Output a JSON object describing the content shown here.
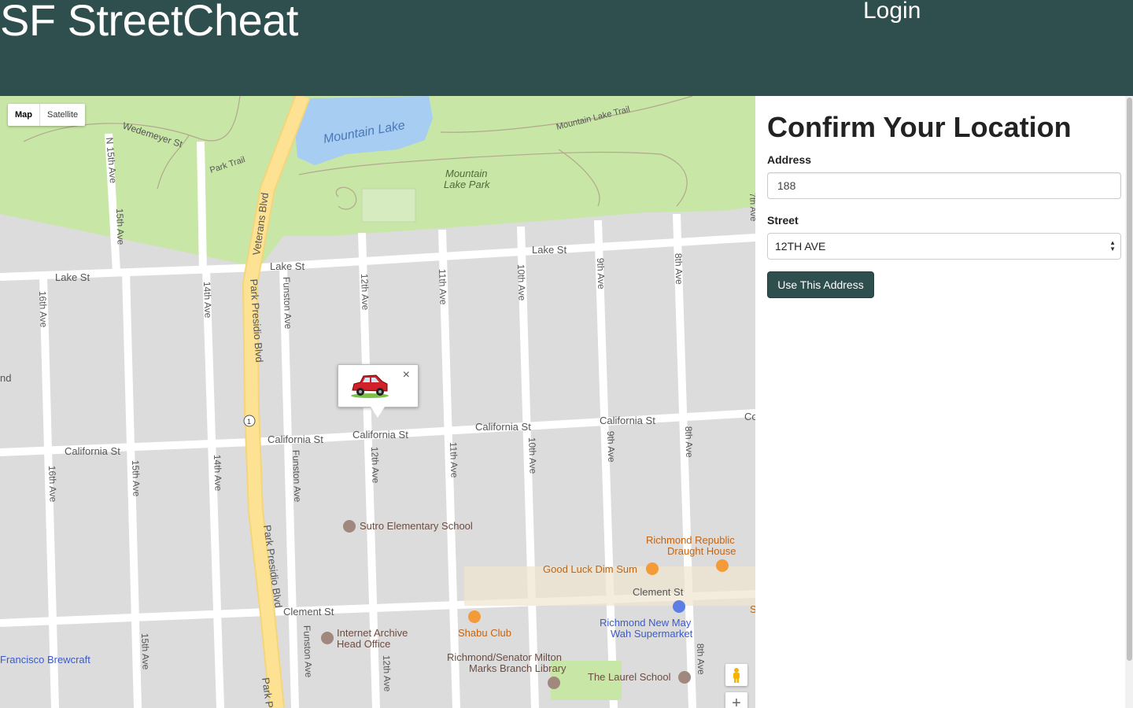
{
  "header": {
    "brand": "SF StreetCheat",
    "login": "Login"
  },
  "map": {
    "type_controls": {
      "map": "Map",
      "satellite": "Satellite"
    },
    "labels": {
      "mountain_lake": "Mountain Lake",
      "mountain_lake_trail": "Mountain Lake Trail",
      "mountain_lake_park_1": "Mountain",
      "mountain_lake_park_2": "Lake Park",
      "wedemeyer": "Wedemeyer St",
      "park_trail": "Park Trail",
      "n15th": "N 15th Ave",
      "veterans": "Veterans Blvd",
      "lake_st_1": "Lake St",
      "lake_st_2": "Lake St",
      "lake_st_3": "Lake St",
      "california_1": "California St",
      "california_2": "California St",
      "california_3": "California St",
      "california_4": "California St",
      "california_5": "California St",
      "clement_1": "Clement St",
      "clement_2": "Clement St",
      "park_presidio_1": "Park Presidio Blvd",
      "park_presidio_2": "Park Presidio Blvd",
      "park_presidio_3": "Park P",
      "funston_1": "Funston Ave",
      "funston_2": "Funston Ave",
      "funston_3": "Funston Ave",
      "ave16_1": "16th Ave",
      "ave16_2": "16th Ave",
      "ave15_1": "15th Ave",
      "ave15_2": "15th Ave",
      "ave15_3": "15th Ave",
      "ave14_1": "14th Ave",
      "ave14_2": "14th Ave",
      "ave12_1": "12th Ave",
      "ave12_2": "12th Ave",
      "ave12_3": "12th Ave",
      "ave11_1": "11th Ave",
      "ave11_2": "11th Ave",
      "ave10_1": "10th Ave",
      "ave10_2": "10th Ave",
      "ave9_1": "9th Ave",
      "ave9_2": "9th Ave",
      "ave8_1": "8th Ave",
      "ave8_2": "8th Ave",
      "ave8_3": "8th Ave",
      "ave7": "7th Ave",
      "nd": "nd",
      "co": "Co",
      "s": "S",
      "route_1": "1"
    },
    "pois": {
      "sutro": "Sutro Elementary School",
      "richmond_republic_1": "Richmond Republic",
      "richmond_republic_2": "Draught House",
      "good_luck": "Good Luck Dim Sum",
      "shabu": "Shabu Club",
      "richmond_new_may_1": "Richmond New May",
      "richmond_new_may_2": "Wah Supermarket",
      "internet_archive_1": "Internet Archive",
      "internet_archive_2": "Head Office",
      "library_1": "Richmond/Senator Milton",
      "library_2": "Marks Branch Library",
      "laurel": "The Laurel School",
      "brewcraft": "Francisco Brewcraft"
    },
    "infowindow": {
      "close": "×"
    },
    "zoom_in": "+"
  },
  "form": {
    "title": "Confirm Your Location",
    "address_label": "Address",
    "address_value": "188",
    "street_label": "Street",
    "street_value": "12TH AVE",
    "submit": "Use This Address"
  },
  "colors": {
    "header": "#2f4f4f",
    "park": "#c8e6a5",
    "water": "#a7cdf2",
    "highway": "#fde293"
  }
}
